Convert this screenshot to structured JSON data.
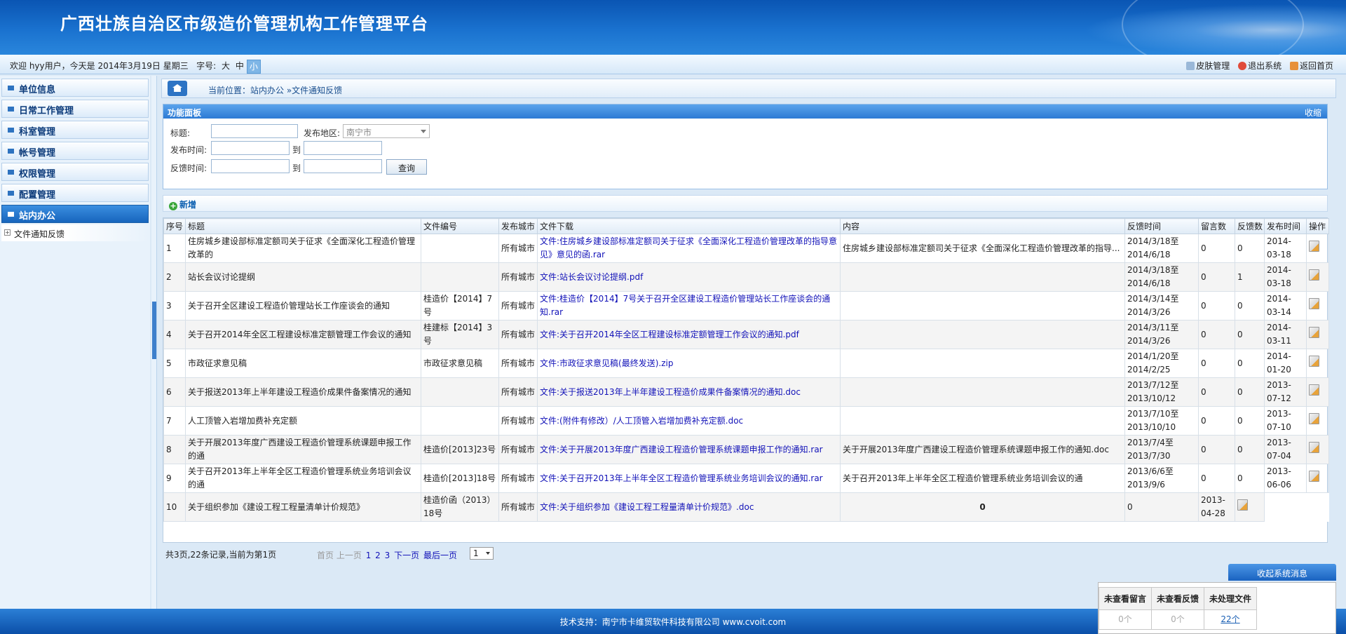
{
  "app": {
    "title": "广西壮族自治区市级造价管理机构工作管理平台"
  },
  "topbar": {
    "welcome": "欢迎 hyy用户，今天是 2014年3月19日 星期三",
    "font_label": "字号:",
    "font_sizes": [
      "大",
      "中",
      "小"
    ],
    "links": [
      "皮肤管理",
      "退出系统",
      "返回首页"
    ]
  },
  "sidebar": {
    "items": [
      {
        "label": "单位信息"
      },
      {
        "label": "日常工作管理"
      },
      {
        "label": "科室管理"
      },
      {
        "label": "帐号管理"
      },
      {
        "label": "权限管理"
      },
      {
        "label": "配置管理"
      },
      {
        "label": "站内办公"
      }
    ],
    "sub_items": [
      {
        "label": "文件通知反馈"
      }
    ]
  },
  "breadcrumb": {
    "text": "当前位置：站内办公 »文件通知反馈"
  },
  "panel": {
    "title": "功能面板",
    "collapse": "收缩",
    "title_label": "标题:",
    "region_label": "发布地区:",
    "region_value": "南宁市",
    "pub_time_label": "发布时间:",
    "to1": "到",
    "fb_time_label": "反馈时间:",
    "to2": "到",
    "query_button": "查询"
  },
  "toolbar": {
    "add_label": "新增"
  },
  "table": {
    "headers": [
      "序号",
      "标题",
      "文件编号",
      "发布城市",
      "文件下载",
      "内容",
      "反馈时间",
      "留言数",
      "反馈数",
      "发布时间",
      "操作"
    ],
    "rows": [
      {
        "no": "1",
        "title": "住房城乡建设部标准定额司关于征求《全面深化工程造价管理改革的",
        "code": "",
        "city": "所有城市",
        "file": "文件:住房城乡建设部标准定额司关于征求《全面深化工程造价管理改革的指导意见》意见的函.rar",
        "content": "住房城乡建设部标准定额司关于征求《全面深化工程造价管理改革的指导...",
        "fb_time": "2014/3/18至2014/6/18",
        "msg": "0",
        "fb": "0",
        "pub": "2014-03-18"
      },
      {
        "no": "2",
        "title": "站长会议讨论提纲",
        "code": "",
        "city": "所有城市",
        "file": "文件:站长会议讨论提纲.pdf",
        "content": "",
        "fb_time": "2014/3/18至2014/6/18",
        "msg": "0",
        "fb": "1",
        "pub": "2014-03-18"
      },
      {
        "no": "3",
        "title": "关于召开全区建设工程造价管理站长工作座谈会的通知",
        "code": "桂造价【2014】7号",
        "city": "所有城市",
        "file": "文件:桂造价【2014】7号关于召开全区建设工程造价管理站长工作座谈会的通知.rar",
        "content": "",
        "fb_time": "2014/3/14至2014/3/26",
        "msg": "0",
        "fb": "0",
        "pub": "2014-03-14"
      },
      {
        "no": "4",
        "title": "关于召开2014年全区工程建设标准定额管理工作会议的通知",
        "code": "桂建标【2014】3号",
        "city": "所有城市",
        "file": "文件:关于召开2014年全区工程建设标准定额管理工作会议的通知.pdf",
        "content": "",
        "fb_time": "2014/3/11至2014/3/26",
        "msg": "0",
        "fb": "0",
        "pub": "2014-03-11"
      },
      {
        "no": "5",
        "title": "市政征求意见稿",
        "code": "市政征求意见稿",
        "city": "所有城市",
        "file": "文件:市政征求意见稿(最终发送).zip",
        "content": "",
        "fb_time": "2014/1/20至2014/2/25",
        "msg": "0",
        "fb": "0",
        "pub": "2014-01-20"
      },
      {
        "no": "6",
        "title": "关于报送2013年上半年建设工程造价成果件备案情况的通知",
        "code": "",
        "city": "所有城市",
        "file": "文件:关于报送2013年上半年建设工程造价成果件备案情况的通知.doc",
        "content": "",
        "fb_time": "2013/7/12至2013/10/12",
        "msg": "0",
        "fb": "0",
        "pub": "2013-07-12"
      },
      {
        "no": "7",
        "title": "人工顶管入岩增加费补充定额",
        "code": "",
        "city": "所有城市",
        "file": "文件:(附件有修改）/人工顶管入岩增加费补充定额.doc",
        "content": "",
        "fb_time": "2013/7/10至2013/10/10",
        "msg": "0",
        "fb": "0",
        "pub": "2013-07-10"
      },
      {
        "no": "8",
        "title": "关于开展2013年度广西建设工程造价管理系统课题申报工作的通",
        "code": "桂造价[2013]23号",
        "city": "所有城市",
        "file": "文件:关于开展2013年度广西建设工程造价管理系统课题申报工作的通知.rar",
        "content": "关于开展2013年度广西建设工程造价管理系统课题申报工作的通知.doc",
        "fb_time": "2013/7/4至2013/7/30",
        "msg": "0",
        "fb": "0",
        "pub": "2013-07-04"
      },
      {
        "no": "9",
        "title": "关于召开2013年上半年全区工程造价管理系统业务培训会议的通",
        "code": "桂造价[2013]18号",
        "city": "所有城市",
        "file": "文件:关于召开2013年上半年全区工程造价管理系统业务培训会议的通知.rar",
        "content": " 关于召开2013年上半年全区工程造价管理系统业务培训会议的通",
        "fb_time": "2013/6/6至2013/9/6",
        "msg": "0",
        "fb": "0",
        "pub": "2013-06-06"
      }
    ],
    "row10": {
      "no": "10",
      "title": "关于组织参加《建设工程工程量清单计价规范》",
      "code": "桂造价函（2013）18号",
      "city": "所有城市",
      "file": "文件:关于组织参加《建设工程工程量清单计价规范》.doc",
      "content": "0",
      "fb_time": "0",
      "pub": "2013-04-28"
    }
  },
  "pager": {
    "info": "共3页,22条记录,当前为第1页",
    "first": "首页",
    "prev": "上一页",
    "pages": [
      "1",
      "2",
      "3"
    ],
    "next": "下一页",
    "last": "最后一页",
    "select": "1"
  },
  "messages": {
    "bar": "收起系统消息",
    "headers": [
      "未查看留言",
      "未查看反馈",
      "未处理文件"
    ],
    "values": [
      "0个",
      "0个",
      "22个"
    ]
  },
  "footer": {
    "text": "技术支持：南宁市卡维贸软件科技有限公司 www.cvoit.com"
  },
  "colors": {
    "header": "#1a72cf",
    "link": "#1212b8",
    "accent": "#2c7ad4"
  }
}
